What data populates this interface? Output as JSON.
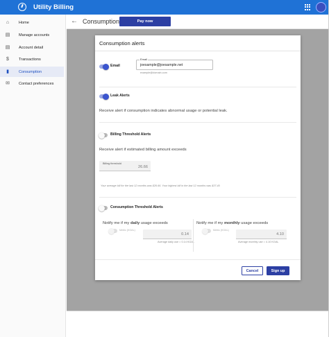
{
  "app": {
    "title": "Utility Billing"
  },
  "sidebar": {
    "items": [
      {
        "label": "Home",
        "icon": "home-icon"
      },
      {
        "label": "Manage accounts",
        "icon": "folder-icon"
      },
      {
        "label": "Account detail",
        "icon": "document-icon"
      },
      {
        "label": "Transactions",
        "icon": "dollar-icon"
      },
      {
        "label": "Consumption",
        "icon": "bar-chart-icon",
        "active": true
      },
      {
        "label": "Contact preferences",
        "icon": "mail-icon"
      }
    ]
  },
  "header": {
    "title": "Consumption",
    "pay_label": "Pay now"
  },
  "modal": {
    "title": "Consumption alerts",
    "email": {
      "label": "Email",
      "field_label": "Email",
      "value": "joesample@joesample.net",
      "helper": "example@domain.com",
      "enabled": true
    },
    "leak": {
      "label": "Leak Alerts",
      "enabled": true,
      "description": "Receive alert if consumption indicates abnormal usage or potential leak."
    },
    "billing": {
      "label": "Billing Threshold Alerts",
      "enabled": false,
      "description": "Receive alert if estimated billing amount exceeds",
      "field_label": "Billing threshold",
      "value": "26.66",
      "hint": "Your average bill for the last 12 months was $26.66. Your highest bill in the last 12 months was $37.40"
    },
    "consumption": {
      "label": "Consumption Threshold Alerts",
      "enabled": false,
      "daily": {
        "prefix": "Notify me if my",
        "emphasis": "daily",
        "suffix": "usage exceeds",
        "toggle_label": "Metric (KGAL)",
        "value": "0.14",
        "hint": "Average daily use = 0.14 KGAL"
      },
      "monthly": {
        "prefix": "Notify me if my",
        "emphasis": "monthly",
        "suffix": "usage exceeds",
        "toggle_label": "Metric (KGAL)",
        "value": "4.10",
        "hint": "Average monthly use = 4.10 KGAL"
      }
    },
    "cancel_label": "Cancel",
    "signup_label": "Sign up"
  },
  "colors": {
    "appbar": "#1f72d6",
    "primary": "#2c3fa3",
    "toggle_on": "#3b55cf"
  }
}
